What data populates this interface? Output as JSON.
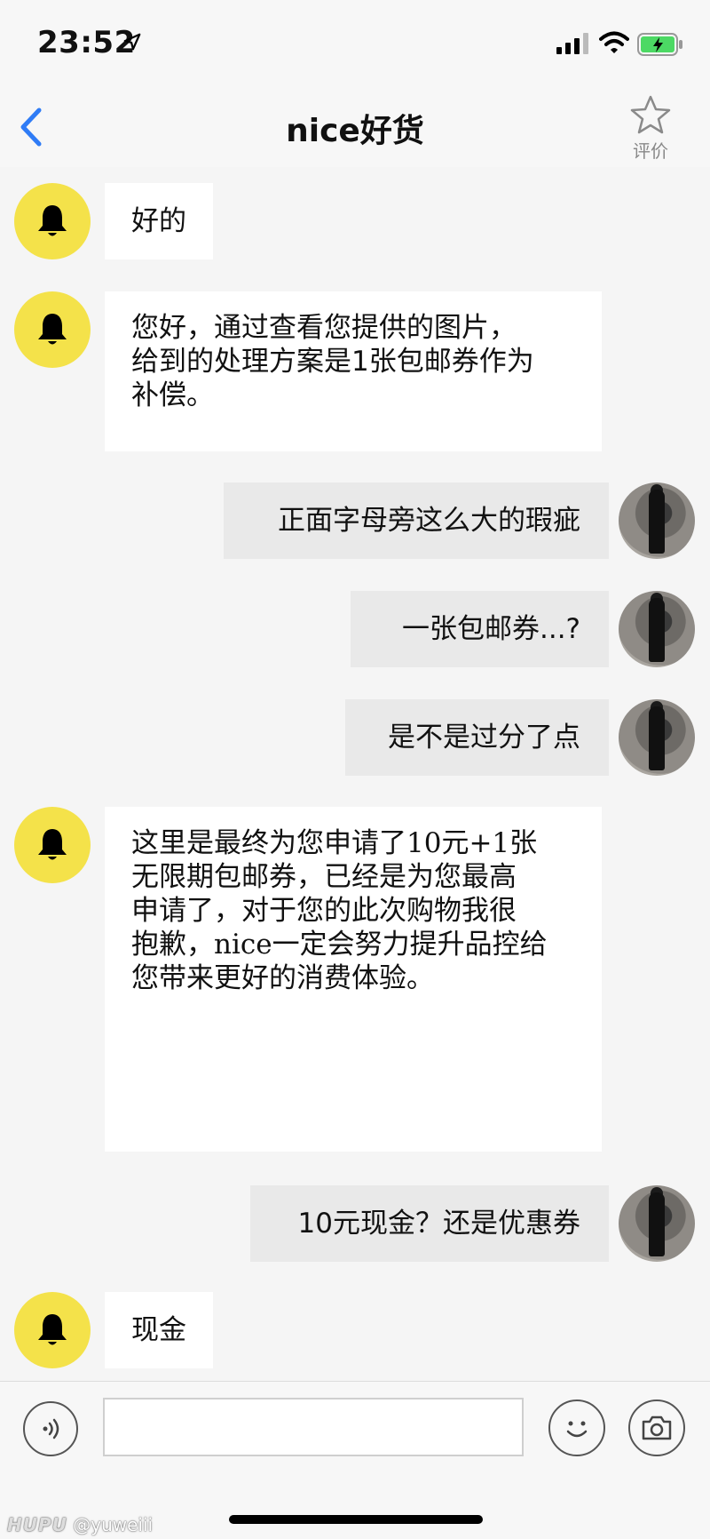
{
  "status_bar": {
    "time": "23:52",
    "icons": [
      "location-arrow-icon",
      "cellular-signal-icon",
      "wifi-icon",
      "battery-charging-icon"
    ],
    "battery_color": "#4cd964"
  },
  "nav": {
    "title": "nice好货",
    "back_icon": "chevron-left-icon",
    "back_color": "#2f7cf6",
    "rate_label": "评价",
    "rate_icon": "star-outline-icon"
  },
  "bot_avatar": {
    "icon": "bell-icon",
    "color": "#f4e24a"
  },
  "messages": [
    {
      "side": "left",
      "text": "好的"
    },
    {
      "side": "left",
      "lines": [
        "您好，通过查看您提供的图片，",
        "给到的处理方案是1张包邮券作为",
        "补偿。"
      ]
    },
    {
      "side": "right",
      "text": "正面字母旁这么大的瑕疵"
    },
    {
      "side": "right",
      "text": "一张包邮券...?"
    },
    {
      "side": "right",
      "text": "是不是过分了点"
    },
    {
      "side": "left",
      "lines": [
        "这里是最终为您申请了10元+1张",
        "无限期包邮券，已经是为您最高",
        "申请了，对于您的此次购物我很",
        "抱歉，nice一定会努力提升品控给",
        "您带来更好的消费体验。"
      ]
    },
    {
      "side": "right",
      "text": "10元现金？还是优惠券"
    },
    {
      "side": "left",
      "text": "现金"
    }
  ],
  "input_bar": {
    "placeholder": "",
    "voice_icon": "voice-icon",
    "emoji_icon": "smiley-icon",
    "camera_icon": "camera-icon"
  },
  "watermark": {
    "brand": "HUPU",
    "user": "@yuweiii"
  }
}
